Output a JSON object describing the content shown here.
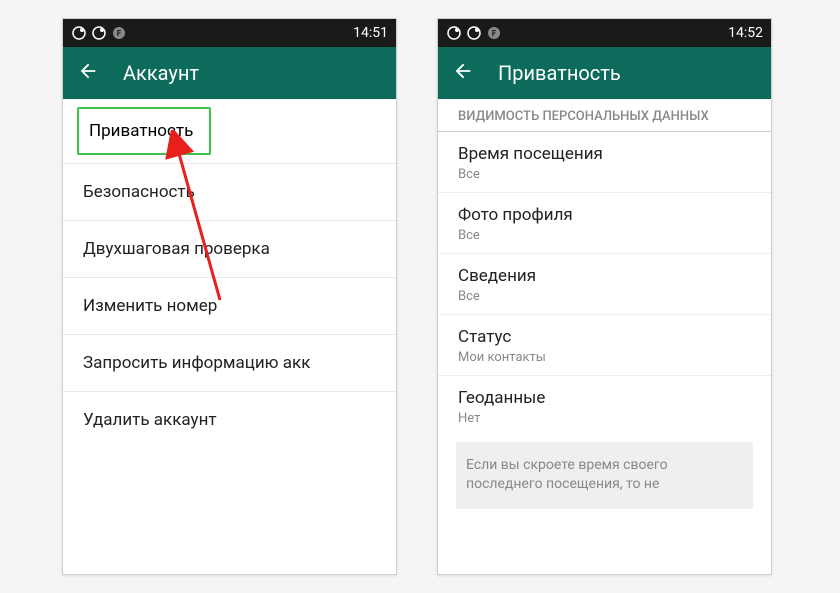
{
  "left": {
    "status_time": "14:51",
    "title": "Аккаунт",
    "items": [
      "Приватность",
      "Безопасность",
      "Двухшаговая проверка",
      "Изменить номер",
      "Запросить информацию акк",
      "Удалить аккаунт"
    ]
  },
  "right": {
    "status_time": "14:52",
    "title": "Приватность",
    "section_header": "ВИДИМОСТЬ ПЕРСОНАЛЬНЫХ ДАННЫХ",
    "settings": [
      {
        "title": "Время посещения",
        "value": "Все"
      },
      {
        "title": "Фото профиля",
        "value": "Все"
      },
      {
        "title": "Сведения",
        "value": "Все"
      },
      {
        "title": "Статус",
        "value": "Мои контакты"
      },
      {
        "title": "Геоданные",
        "value": "Нет"
      }
    ],
    "info_text": "Если вы скроете время своего последнего посещения, то не"
  }
}
